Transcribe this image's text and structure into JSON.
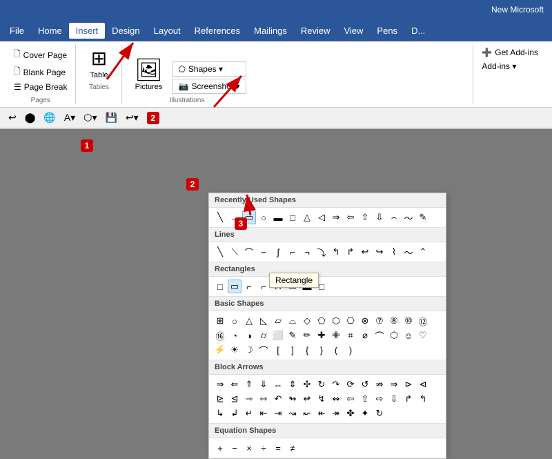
{
  "titlebar": {
    "text": "New Microsoft"
  },
  "menubar": {
    "items": [
      "File",
      "Home",
      "Insert",
      "Design",
      "Layout",
      "References",
      "Mailings",
      "Review",
      "View",
      "Pens",
      "D..."
    ]
  },
  "ribbon": {
    "insert_tab": "Insert",
    "groups": {
      "pages": {
        "label": "Pages",
        "buttons": [
          "Cover Page",
          "Blank Page",
          "Page Break"
        ],
        "number": "1"
      },
      "tables": {
        "label": "Tables",
        "button": "Table"
      },
      "illustrations": {
        "label": "Illustrations",
        "pictures": "Pictures",
        "shapes": "Shapes",
        "screenshot": "Screenshot",
        "number": "2"
      }
    }
  },
  "shapes_dropdown": {
    "sections": [
      {
        "title": "Recently Used Shapes",
        "shapes": [
          "line",
          "arrow",
          "rect",
          "oval",
          "rect2",
          "rect3",
          "tri",
          "pentag",
          "arrow2",
          "arrow3",
          "arrow4",
          "arrow5",
          "arc",
          "wave",
          "freeform"
        ]
      },
      {
        "title": "Lines",
        "shapes": [
          "line",
          "diag",
          "curve",
          "bend",
          "bend2",
          "step",
          "step2",
          "arc2",
          "arc3",
          "spiral",
          "elbow",
          "elbow2",
          "wave2",
          "curve2",
          "squig"
        ]
      },
      {
        "title": "Rectangles",
        "shapes": [
          "rect",
          "roundrect",
          "snip1",
          "snip2",
          "snipround",
          "snip2",
          "snip3",
          "roundrect2"
        ],
        "number": "3"
      },
      {
        "title": "Basic Shapes",
        "shapes": [
          "text",
          "oval",
          "triangle",
          "rtriangle",
          "para",
          "trap",
          "diamond",
          "penta",
          "hexa",
          "hepta",
          "octa",
          "circ7",
          "circ8",
          "circ10",
          "circ12",
          "pie",
          "chord",
          "teardrop",
          "frame",
          "halfframe",
          "corner",
          "diag",
          "plus",
          "cross",
          "plaque",
          "can",
          "cube",
          "bevel",
          "donut",
          "noshape",
          "smiley",
          "heart",
          "lightning",
          "sun",
          "moon",
          "arc",
          "bracket1",
          "bracket2",
          "brace1",
          "brace2",
          "leftbrace",
          "rightbrace"
        ]
      },
      {
        "title": "Block Arrows",
        "shapes": [
          "rightarrow",
          "leftarrow",
          "uparrow",
          "downarrow",
          "leftrightarrow",
          "updownarrow",
          "fourbody",
          "circlearrow",
          "rightbentarrow",
          "uturn",
          "leftbentarrow",
          "rightarrow2",
          "rightarrow3",
          "leftarrow3",
          "callout",
          "quad",
          "callout2",
          "leftarrow4",
          "rightarrow4",
          "uparrow2",
          "pentarrow",
          "homeplate",
          "chevron",
          "leftright",
          "rightleft",
          "updown",
          "updown2",
          "plus2",
          "cornerbend",
          "bendbend",
          "cornerbend2",
          "lefthalf",
          "righthalf",
          "topleft",
          "topright",
          "bottomleft",
          "bottomright",
          "arrowright",
          "leftright2",
          "updownarrow2",
          "circleup"
        ]
      },
      {
        "title": "Equation Shapes",
        "shapes": [
          "plus",
          "minus",
          "multiply",
          "divide",
          "equals",
          "notequals"
        ]
      }
    ]
  },
  "rectangle_tooltip": "Rectangle",
  "annotations": {
    "badge1_label": "1",
    "badge2_label": "2",
    "badge3_label": "3"
  }
}
